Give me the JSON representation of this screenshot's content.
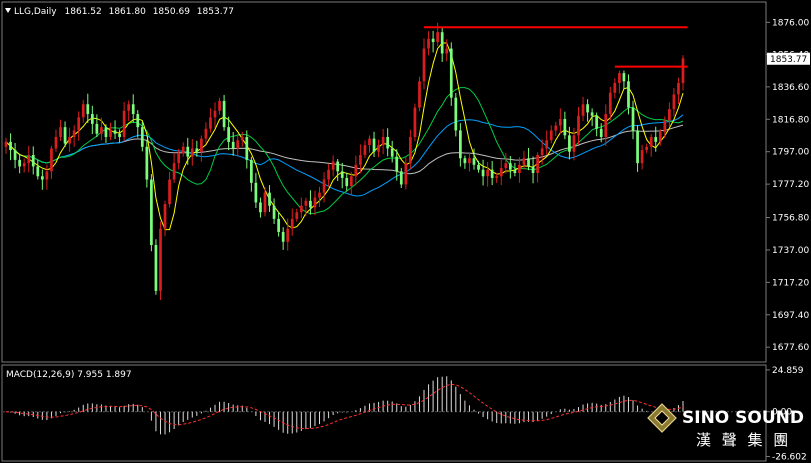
{
  "chart_data": [
    {
      "type": "candlestick",
      "header": {
        "symbol_label": "LLG,Daily",
        "ohlc": [
          "1861.52",
          "1861.80",
          "1850.69",
          "1853.77"
        ]
      },
      "current_price": "1853.77",
      "ylim": [
        1671,
        1886
      ],
      "yticks": [
        "1876.00",
        "1856.40",
        "1836.60",
        "1816.80",
        "1797.00",
        "1777.20",
        "1756.80",
        "1737.00",
        "1717.20",
        "1697.40",
        "1677.60"
      ],
      "ytick_values": [
        1876.0,
        1856.4,
        1836.6,
        1816.8,
        1797.0,
        1777.2,
        1756.8,
        1737.0,
        1717.2,
        1697.4,
        1677.6
      ],
      "colors": {
        "bull": "#d81e1e",
        "bear": "#7cfc7c",
        "resistance": "#ff0000",
        "ma_fast": "#ffff00",
        "ma_mid": "#00cc44",
        "ma_slow": "#00a0ff",
        "ma_long": "#c0c0c0"
      },
      "resistance_levels": [
        {
          "value": 1873.0,
          "from_bar": 92,
          "to_bar": 150
        },
        {
          "value": 1849.0,
          "from_bar": 134,
          "to_bar": 150
        }
      ],
      "closes": [
        1803,
        1798,
        1792,
        1788,
        1790,
        1795,
        1788,
        1782,
        1780,
        1785,
        1799,
        1806,
        1812,
        1802,
        1806,
        1810,
        1818,
        1826,
        1820,
        1814,
        1808,
        1812,
        1806,
        1810,
        1808,
        1806,
        1822,
        1826,
        1820,
        1812,
        1800,
        1780,
        1740,
        1712,
        1750,
        1765,
        1780,
        1790,
        1796,
        1800,
        1794,
        1799,
        1797,
        1805,
        1811,
        1818,
        1822,
        1828,
        1812,
        1803,
        1799,
        1804,
        1806,
        1792,
        1778,
        1766,
        1760,
        1772,
        1764,
        1756,
        1748,
        1742,
        1750,
        1756,
        1760,
        1764,
        1767,
        1763,
        1769,
        1772,
        1780,
        1786,
        1791,
        1785,
        1781,
        1776,
        1782,
        1789,
        1795,
        1801,
        1805,
        1797,
        1801,
        1806,
        1799,
        1794,
        1785,
        1777,
        1790,
        1806,
        1824,
        1840,
        1860,
        1866,
        1864,
        1870,
        1857,
        1860,
        1830,
        1810,
        1793,
        1790,
        1793,
        1789,
        1786,
        1782,
        1786,
        1781,
        1782,
        1787,
        1790,
        1786,
        1784,
        1789,
        1793,
        1788,
        1784,
        1795,
        1799,
        1804,
        1810,
        1813,
        1817,
        1807,
        1797,
        1807,
        1819,
        1826,
        1821,
        1819,
        1811,
        1806,
        1820,
        1833,
        1839,
        1845,
        1840,
        1824,
        1810,
        1790,
        1798,
        1800,
        1806,
        1803,
        1809,
        1816,
        1823,
        1832,
        1839,
        1854
      ]
    },
    {
      "type": "bar",
      "header": {
        "label": "MACD(12,26,9) 7.955 1.897"
      },
      "ylim": [
        -27.5,
        26
      ],
      "yticks": [
        "24.859",
        "0.00",
        "-26.602"
      ],
      "ytick_values": [
        24.859,
        0.0,
        -26.602
      ],
      "colors": {
        "histogram": "#dcdcdc",
        "signal": "#ff3030",
        "zero": "#505050"
      }
    }
  ],
  "branding": {
    "title": "SINO SOUND",
    "subtitle": "漢 聲 集 團"
  }
}
